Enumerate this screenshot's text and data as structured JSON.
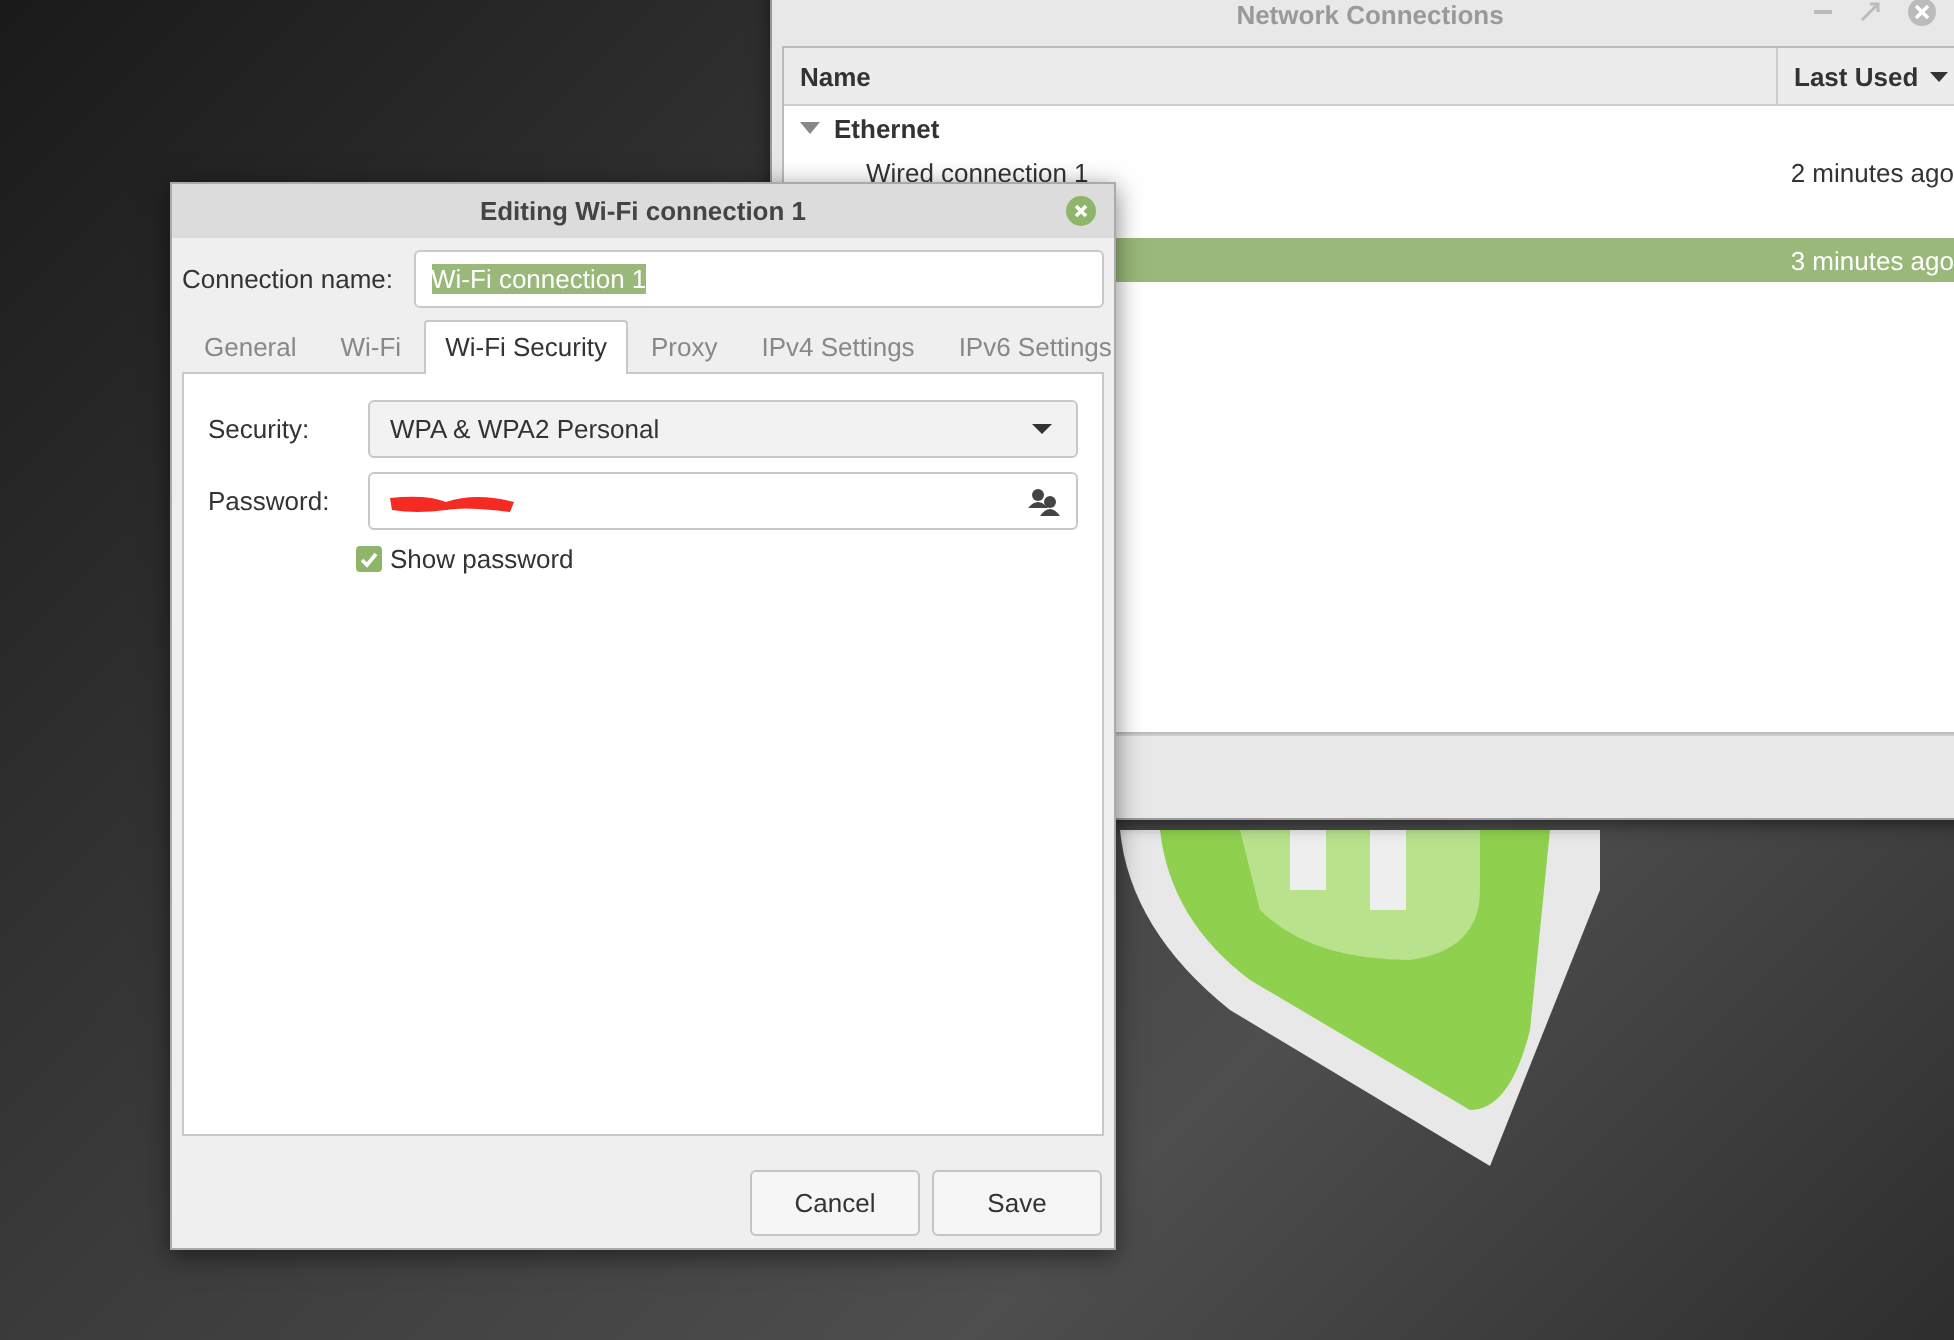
{
  "background_window": {
    "title": "Network Connections",
    "columns": [
      "Name",
      "Last Used"
    ],
    "groups": [
      {
        "name": "Ethernet",
        "expanded": true,
        "rows": [
          {
            "name": "Wired connection 1",
            "last_used": "2 minutes ago",
            "selected": false
          }
        ]
      },
      {
        "rows": [
          {
            "last_used": "3 minutes ago",
            "selected": true
          }
        ]
      }
    ]
  },
  "dialog": {
    "title": "Editing Wi-Fi connection 1",
    "connection_name_label": "Connection name:",
    "connection_name": "Wi-Fi connection 1",
    "tabs": [
      {
        "label": "General",
        "selected": false
      },
      {
        "label": "Wi-Fi",
        "selected": false
      },
      {
        "label": "Wi-Fi Security",
        "selected": true
      },
      {
        "label": "Proxy",
        "selected": false
      },
      {
        "label": "IPv4 Settings",
        "selected": false
      },
      {
        "label": "IPv6 Settings",
        "selected": false
      }
    ],
    "security_label": "Security:",
    "security_value": "WPA & WPA2 Personal",
    "password_label": "Password:",
    "password_redacted": true,
    "show_password": {
      "label": "Show password",
      "checked": true
    },
    "buttons": [
      "Cancel",
      "Save"
    ]
  }
}
